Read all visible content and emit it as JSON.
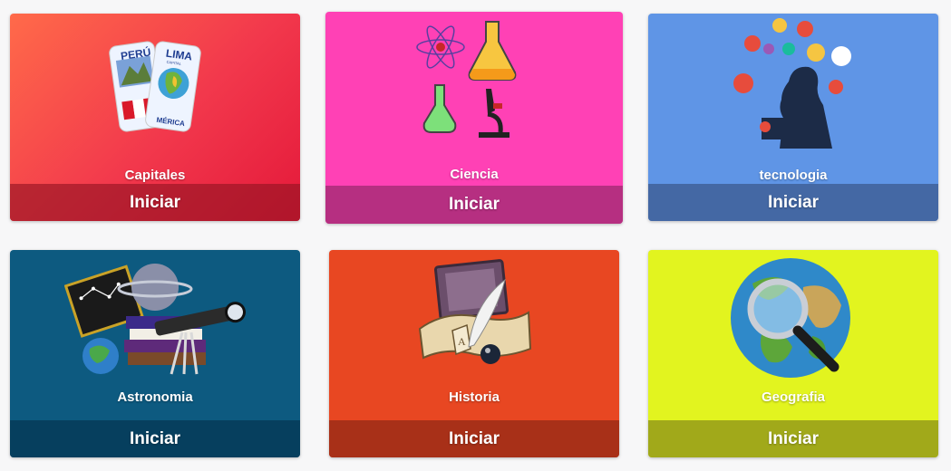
{
  "cards": [
    {
      "title": "Capitales",
      "button": "Iniciar",
      "image_icon": "peru-lima-cards-icon",
      "stamp_text": [
        "PERÚ",
        "LIMA",
        "CAPITAL",
        "MÉRICA"
      ]
    },
    {
      "title": "Ciencia",
      "button": "Iniciar",
      "image_icon": "science-lab-icon"
    },
    {
      "title": "tecnologia",
      "button": "Iniciar",
      "image_icon": "technology-person-icon"
    },
    {
      "title": "Astronomia",
      "button": "Iniciar",
      "image_icon": "telescope-books-icon"
    },
    {
      "title": "Historia",
      "button": "Iniciar",
      "image_icon": "quill-scroll-icon"
    },
    {
      "title": "Geografia",
      "button": "Iniciar",
      "image_icon": "globe-magnifier-icon"
    }
  ],
  "colors": {
    "capitales": "#f2384c",
    "ciencia": "#ff41b5",
    "tecnologia": "#5f95e6",
    "astronomia": "#0d5a80",
    "historia": "#e84722",
    "geografia": "#e2f41f"
  }
}
